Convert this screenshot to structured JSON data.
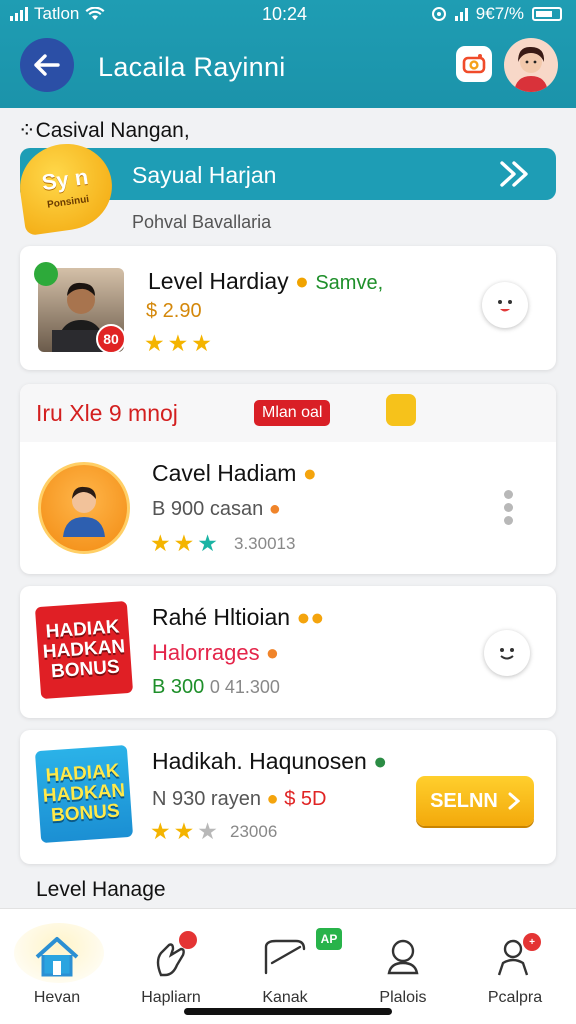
{
  "status_bar": {
    "carrier": "Tatlon",
    "time": "10:24",
    "battery": "9€7/%"
  },
  "header": {
    "title": "Lacaila Rayinni"
  },
  "section": {
    "label": "Casival Nangan,"
  },
  "promo": {
    "badge_top": "Sy n",
    "badge_bottom": "Ponsinui",
    "title": "Sayual Harjan",
    "subtitle": "Pohval Bavallaria"
  },
  "cards": [
    {
      "title": "Level Hardiay",
      "tag": "Samve,",
      "price": "$ 2.90",
      "rating": 3
    },
    {
      "title": "Cavel Hadiam",
      "price": "B 900 casan",
      "rating": 3,
      "extra": "3.30013"
    },
    {
      "title": "Rahé Hltioian",
      "subtitle": "Halorrages",
      "price": "B 300",
      "extra": "0 41.300"
    },
    {
      "title": "Hadikah. Haqunosen",
      "price": "N 930 rayen",
      "amount": "$ 5D",
      "rating": 3,
      "extra": "23006",
      "button": "SELNN"
    }
  ],
  "strip": {
    "left": "Iru Xle 9 mnoj",
    "pill": "Mlan oal"
  },
  "bonus_text": [
    "HADIAK",
    "HADKAN",
    "BONUS"
  ],
  "card1_badge": "80",
  "footer": {
    "label": "Level Hanage"
  },
  "nav": [
    {
      "label": "Hevan",
      "icon": "home-icon"
    },
    {
      "label": "Hapliarn",
      "icon": "hand-icon"
    },
    {
      "label": "Kanak",
      "icon": "tag-icon"
    },
    {
      "label": "Plalois",
      "icon": "user-icon"
    },
    {
      "label": "Pcalpra",
      "icon": "profile-icon"
    }
  ],
  "nav_badge": "AP",
  "colors": {
    "header": "#1f9db3",
    "accent_yellow": "#f6b819",
    "accent_red": "#d91f26",
    "star": "#f4b400"
  }
}
